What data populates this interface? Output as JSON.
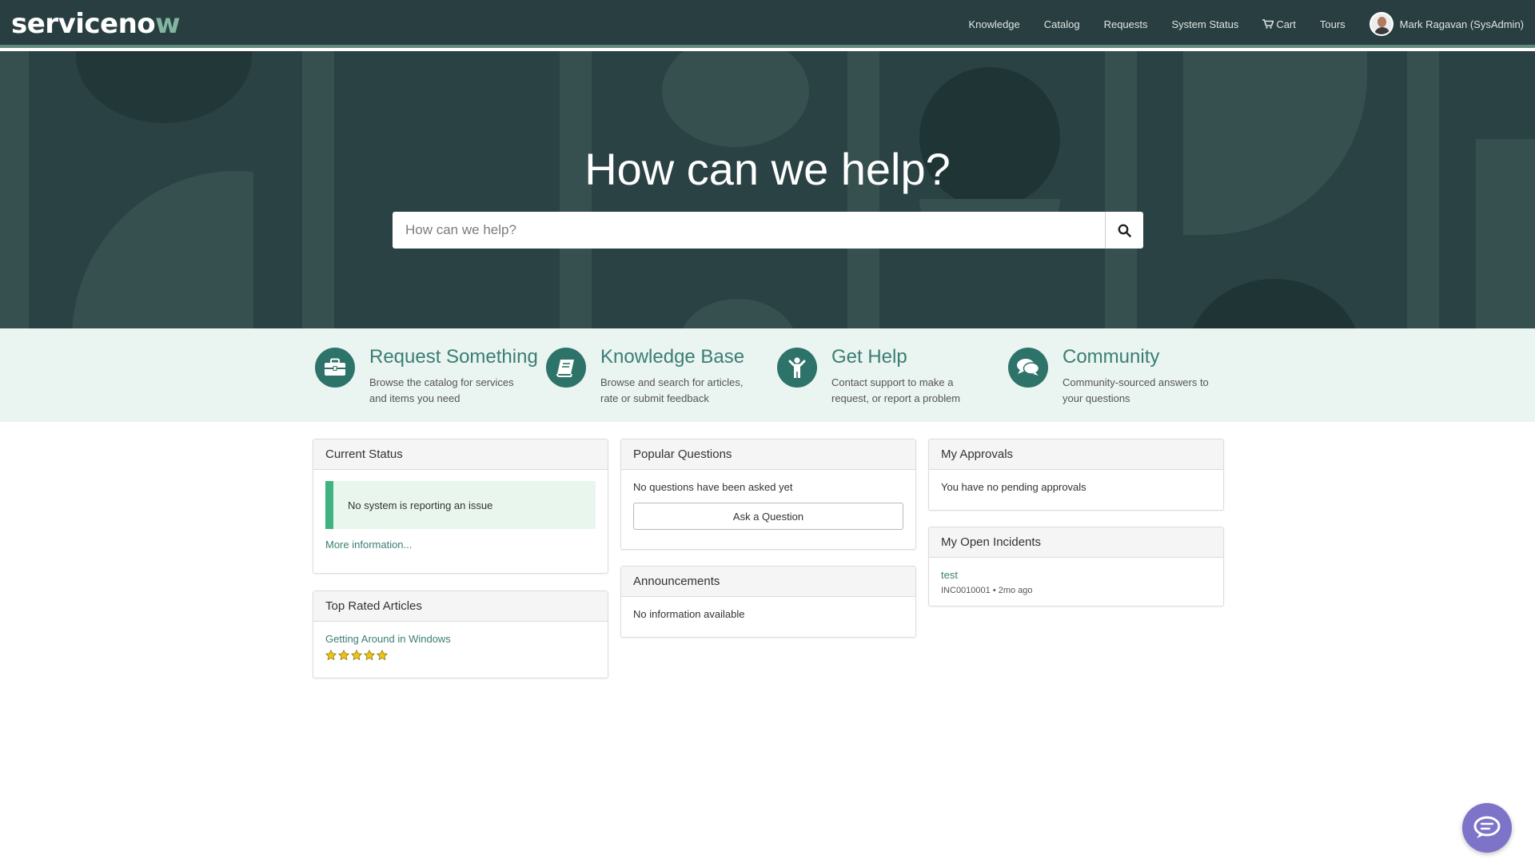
{
  "header": {
    "logo_text": "servicenow",
    "nav": [
      "Knowledge",
      "Catalog",
      "Requests",
      "System Status",
      "Cart",
      "Tours"
    ],
    "user": "Mark Ragavan (SysAdmin)"
  },
  "hero": {
    "title": "How can we help?",
    "search_placeholder": "How can we help?"
  },
  "quick_links": [
    {
      "title": "Request Something",
      "desc": "Browse the catalog for services and items you need",
      "icon": "briefcase-icon"
    },
    {
      "title": "Knowledge Base",
      "desc": "Browse and search for articles, rate or submit feedback",
      "icon": "book-icon"
    },
    {
      "title": "Get Help",
      "desc": "Contact support to make a request, or report a problem",
      "icon": "person-help-icon"
    },
    {
      "title": "Community",
      "desc": "Community-sourced answers to your questions",
      "icon": "chat-bubbles-icon"
    }
  ],
  "widgets": {
    "current_status": {
      "title": "Current Status",
      "message": "No system is reporting an issue",
      "link": "More information..."
    },
    "top_rated": {
      "title": "Top Rated Articles",
      "article": "Getting Around in Windows",
      "rating": 5
    },
    "popular_questions": {
      "title": "Popular Questions",
      "message": "No questions have been asked yet",
      "button": "Ask a Question"
    },
    "announcements": {
      "title": "Announcements",
      "message": "No information available"
    },
    "my_approvals": {
      "title": "My Approvals",
      "message": "You have no pending approvals"
    },
    "open_incidents": {
      "title": "My Open Incidents",
      "item_title": "test",
      "item_meta": "INC0010001 • 2mo ago"
    }
  },
  "colors": {
    "header_bg": "#293e40",
    "accent": "#3a7e73",
    "band_bg": "#eaf4f1",
    "status_green": "#3fb37f",
    "chat_bg": "#7d73c9"
  }
}
